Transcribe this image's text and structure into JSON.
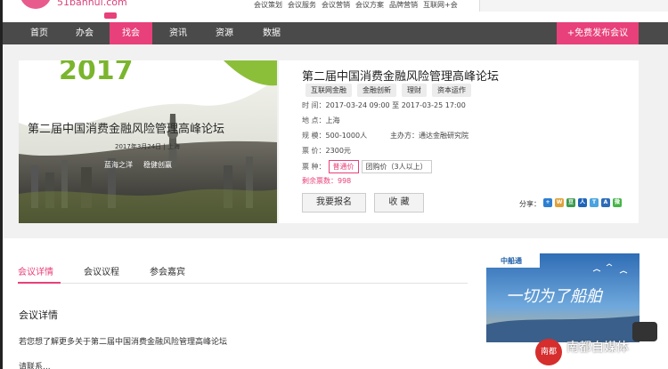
{
  "site": {
    "logo_text": "51banhui.com"
  },
  "top_links": [
    "会议策划",
    "会议服务",
    "会议营销",
    "会议方案",
    "品牌营销",
    "互联网+会"
  ],
  "nav": {
    "items": [
      {
        "label": "首页",
        "active": false
      },
      {
        "label": "办会",
        "active": false
      },
      {
        "label": "找会",
        "active": true
      },
      {
        "label": "资讯",
        "active": false
      },
      {
        "label": "资源",
        "active": false
      },
      {
        "label": "数据",
        "active": false
      }
    ],
    "publish_label": "+免费发布会议"
  },
  "banner": {
    "year": "2017",
    "title": "第二届中国消费金融风险管理高峰论坛",
    "date_place": "2017年3月24日 | 上海",
    "slogan_a": "蓝海之洋",
    "slogan_b": "稳健创赢"
  },
  "conference": {
    "title": "第二届中国消费金融风险管理高峰论坛",
    "tags": [
      "互联网金融",
      "金融创新",
      "理财",
      "资本运作"
    ],
    "time_label": "时 间：",
    "time_value": "2017-03-24 09:00 至 2017-03-25 17:00",
    "location_label": "地 点：",
    "location_value": "上海",
    "scale_label": "规 模：",
    "scale_value": "500-1000人",
    "organizer_label": "主办方：",
    "organizer_value": "通达金融研究院",
    "price_label": "票 价：",
    "price_value": "2300元",
    "ticket_label": "票 种：",
    "ticket_options": [
      "普通价",
      "团购价（3人以上）"
    ],
    "remaining_label": "剩余票数：",
    "remaining_value": "998",
    "register_label": "我要报名",
    "favorite_label": "收 藏",
    "share_label": "分享："
  },
  "share_icons": [
    {
      "name": "qzone",
      "glyph": "+",
      "color": "#2c7fd1"
    },
    {
      "name": "weibo",
      "glyph": "W",
      "color": "#e0a23b"
    },
    {
      "name": "douban",
      "glyph": "豆",
      "color": "#3c9a4e"
    },
    {
      "name": "renren",
      "glyph": "人",
      "color": "#1f64b8"
    },
    {
      "name": "tqq",
      "glyph": "T",
      "color": "#4aa3df"
    },
    {
      "name": "people",
      "glyph": "A",
      "color": "#2d6cb8"
    },
    {
      "name": "wechat",
      "glyph": "微",
      "color": "#46b548"
    }
  ],
  "detail_tabs": [
    {
      "label": "会议详情",
      "active": true
    },
    {
      "label": "会议议程",
      "active": false
    },
    {
      "label": "参会嘉宾",
      "active": false
    }
  ],
  "details": {
    "heading": "会议详情",
    "intro": "若您想了解更多关于第二届中国消费金融风险管理高峰论坛",
    "cut_line": "请联系..."
  },
  "ad": {
    "brand": "中船通",
    "slogan": "一切为了船舶"
  },
  "watermark": {
    "badge": "南都",
    "text": "南都自媒体"
  },
  "colors": {
    "accent": "#e8407a",
    "nav_bg": "#4a4a4a",
    "hero_bg": "#f1f1f1"
  }
}
